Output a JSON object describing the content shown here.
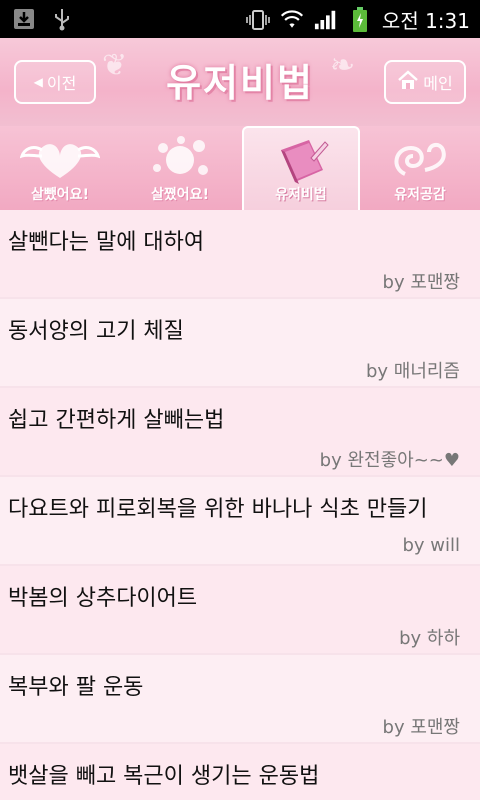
{
  "status": {
    "time": "오전 1:31"
  },
  "header": {
    "back_label": "이전",
    "title": "유저비법",
    "main_label": "메인"
  },
  "tabs": [
    {
      "label": "살뺐어요!"
    },
    {
      "label": "살쪘어요!"
    },
    {
      "label": "유저비법"
    },
    {
      "label": "유저공감"
    }
  ],
  "items": [
    {
      "title": "살뺀다는 말에 대하여",
      "author": "by 포맨짱"
    },
    {
      "title": "동서양의 고기 체질",
      "author": "by 매너리즘"
    },
    {
      "title": "쉽고 간편하게 살빼는법",
      "author": "by 완전좋아~~♥"
    },
    {
      "title": "다요트와 피로회복을 위한 바나나 식초 만들기",
      "author": "by will"
    },
    {
      "title": "박봄의 상추다이어트",
      "author": "by 하하"
    },
    {
      "title": "복부와 팔 운동",
      "author": "by 포맨짱"
    },
    {
      "title": "뱃살을 빼고 복근이 생기는 운동법",
      "author": ""
    }
  ],
  "colors": {
    "accent": "#f4b3ca",
    "list_bg": "#fde8ef",
    "author": "#777777"
  }
}
